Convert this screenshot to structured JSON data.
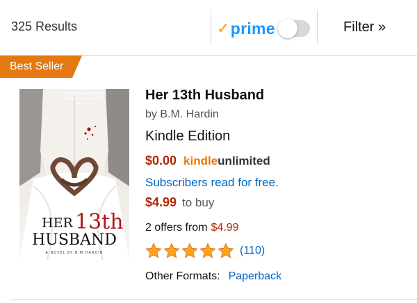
{
  "header": {
    "results_count": "325 Results",
    "prime_label": "prime",
    "prime_toggle_on": false,
    "filter_label": "Filter »"
  },
  "badge": {
    "label": "Best Seller"
  },
  "product": {
    "title": "Her 13th Husband",
    "author": "by B.M. Hardin",
    "format": "Kindle Edition",
    "ku_price": "$0.00",
    "ku_kindle": "kindle",
    "ku_unlimited": "unlimited",
    "subscribers_text": "Subscribers read for free.",
    "buy_price": "$4.99",
    "buy_text": "to buy",
    "offers_text": "2 offers from",
    "offers_price": "$4.99",
    "rating_stars": 5,
    "review_count": "(110)",
    "other_formats_label": "Other Formats:",
    "other_formats_link": "Paperback"
  },
  "cover": {
    "tagline_line1": "Finding A Husband is Easy.",
    "tagline_line2": "Keeping Them Alive is The",
    "tagline_line3": "Problem.",
    "title_her": "HER",
    "title_13th": "13th",
    "title_husband": "HUSBAND",
    "subtitle": "A NOVEL BY B.M.HARDIN"
  },
  "colors": {
    "price_red": "#b12704",
    "link_blue": "#0066c0",
    "badge_orange": "#e47911",
    "star_gold": "#ffa41c",
    "prime_blue": "#1a98ff"
  }
}
